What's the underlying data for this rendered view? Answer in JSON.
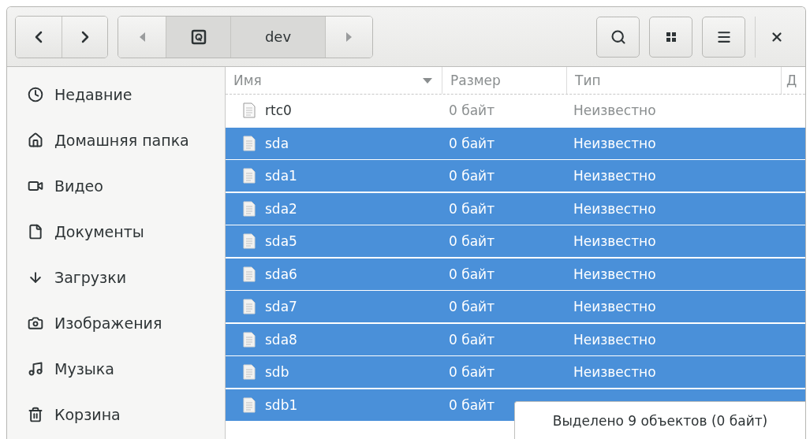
{
  "toolbar": {
    "path": [
      {
        "label": "dev",
        "selected": true
      }
    ]
  },
  "sidebar": {
    "items": [
      {
        "label": "Недавние",
        "kind": "recent"
      },
      {
        "label": "Домашняя папка",
        "kind": "home"
      },
      {
        "label": "Видео",
        "kind": "video"
      },
      {
        "label": "Документы",
        "kind": "documents"
      },
      {
        "label": "Загрузки",
        "kind": "downloads"
      },
      {
        "label": "Изображения",
        "kind": "pictures"
      },
      {
        "label": "Музыка",
        "kind": "music"
      },
      {
        "label": "Корзина",
        "kind": "trash"
      }
    ]
  },
  "table": {
    "columns": [
      "Имя",
      "Размер",
      "Тип",
      "Д"
    ],
    "rows": [
      {
        "name": "rtc0",
        "size": "0 байт",
        "type": "Неизвестно",
        "selected": false
      },
      {
        "name": "sda",
        "size": "0 байт",
        "type": "Неизвестно",
        "selected": true
      },
      {
        "name": "sda1",
        "size": "0 байт",
        "type": "Неизвестно",
        "selected": true
      },
      {
        "name": "sda2",
        "size": "0 байт",
        "type": "Неизвестно",
        "selected": true
      },
      {
        "name": "sda5",
        "size": "0 байт",
        "type": "Неизвестно",
        "selected": true
      },
      {
        "name": "sda6",
        "size": "0 байт",
        "type": "Неизвестно",
        "selected": true
      },
      {
        "name": "sda7",
        "size": "0 байт",
        "type": "Неизвестно",
        "selected": true
      },
      {
        "name": "sda8",
        "size": "0 байт",
        "type": "Неизвестно",
        "selected": true
      },
      {
        "name": "sdb",
        "size": "0 байт",
        "type": "Неизвестно",
        "selected": true
      },
      {
        "name": "sdb1",
        "size": "0 байт",
        "selected": true
      }
    ]
  },
  "status": "Выделено 9 объектов  (0 байт)"
}
